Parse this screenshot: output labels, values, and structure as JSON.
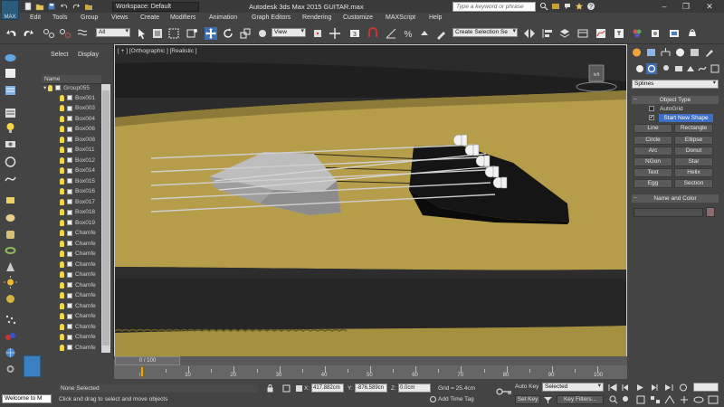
{
  "window": {
    "title": "Autodesk 3ds Max 2015    GUITAR.max",
    "workspace": "Workspace: Default",
    "search_placeholder": "Type a keyword or phrase",
    "logo_text": "MAX"
  },
  "menu": [
    "Edit",
    "Tools",
    "Group",
    "Views",
    "Create",
    "Modifiers",
    "Animation",
    "Graph Editors",
    "Rendering",
    "Customize",
    "MAXScript",
    "Help"
  ],
  "toolbar": {
    "filter": "All",
    "ref_coord": "View",
    "selection_set": "Create Selection Se"
  },
  "explorer": {
    "tab_select": "Select",
    "tab_display": "Display",
    "column_header": "Name",
    "items": [
      "Group055",
      "Box001",
      "Box003",
      "Box004",
      "Box006",
      "Box008",
      "Box011",
      "Box012",
      "Box014",
      "Box015",
      "Box016",
      "Box017",
      "Box018",
      "Box019",
      "Chamfe",
      "Chamfe",
      "Chamfe",
      "Chamfe",
      "Chamfe",
      "Chamfe",
      "Chamfe",
      "Chamfe",
      "Chamfe",
      "Chamfe",
      "Chamfe",
      "Chamfe"
    ]
  },
  "viewport": {
    "label": "[ + ] [Orthographic ] [Realistic ]",
    "cube_label": "left"
  },
  "command_panel": {
    "category": "Splines",
    "object_type_title": "Object Type",
    "autogrid": "AutoGrid",
    "start_new_shape": "Start New Shape",
    "buttons": [
      "Line",
      "Rectangle",
      "Circle",
      "Ellipse",
      "Arc",
      "Donut",
      "NGon",
      "Star",
      "Text",
      "Helix",
      "Egg",
      "Section"
    ],
    "name_color_title": "Name and Color"
  },
  "timeline": {
    "slider_text": "0 / 100",
    "ticks": [
      "0",
      "10",
      "20",
      "30",
      "40",
      "50",
      "60",
      "70",
      "80",
      "90",
      "100"
    ]
  },
  "status": {
    "listener": "Welcome to M",
    "selection": "None Selected",
    "prompt": "Click and drag to select and move objects",
    "x_label": "X:",
    "x_value": "417.882cm",
    "y_label": "Y:",
    "y_value": "-876.589cn",
    "z_label": "Z:",
    "z_value": "0.0cm",
    "grid": "Grid = 25.4cm",
    "add_time_tag": "Add Time Tag",
    "auto_key": "Auto Key",
    "set_key": "Set Key",
    "selected": "Selected",
    "key_filters": "Key Filters..."
  }
}
